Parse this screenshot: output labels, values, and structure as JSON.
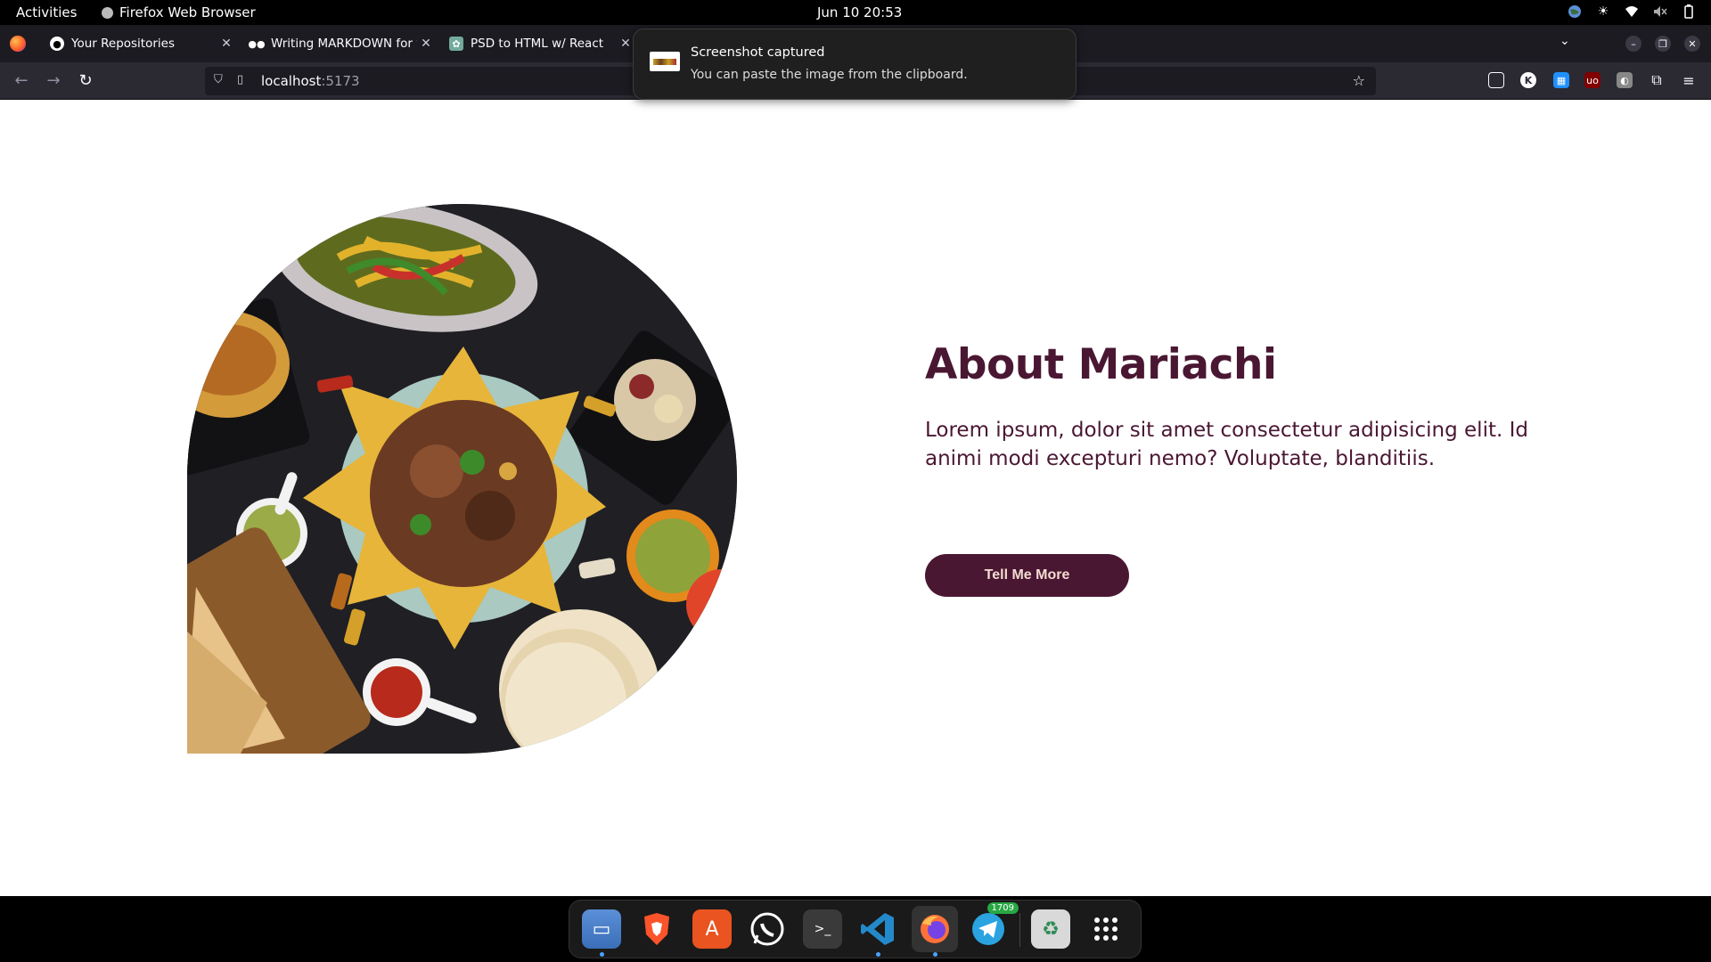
{
  "system": {
    "activities": "Activities",
    "app_name": "Firefox Web Browser",
    "clock": "Jun 10  20:53"
  },
  "browser": {
    "tabs": [
      {
        "label": "Your Repositories",
        "favicon": "github-icon"
      },
      {
        "label": "Writing MARKDOWN for your",
        "favicon": "medium-icon"
      },
      {
        "label": "PSD to HTML w/ React",
        "favicon": "chatgpt-icon"
      }
    ],
    "url_host": "localhost",
    "url_port": ":5173"
  },
  "notification": {
    "title": "Screenshot captured",
    "body": "You can paste the image from the clipboard."
  },
  "page": {
    "heading": "About Mariachi",
    "paragraph": "Lorem ipsum, dolor sit amet consectetur adipisicing elit. Id animi modi excepturi nemo? Voluptate, blanditiis.",
    "button": "Tell Me More",
    "colors": {
      "accent": "#4a1733",
      "button_text": "#f3dcd0"
    }
  },
  "dock": {
    "apps": [
      "files-icon",
      "brave-icon",
      "app-center-icon",
      "whatsapp-icon",
      "terminal-icon",
      "vscode-icon",
      "firefox-icon",
      "telegram-icon",
      "trash-icon",
      "app-grid-icon"
    ],
    "telegram_badge": "1709"
  }
}
